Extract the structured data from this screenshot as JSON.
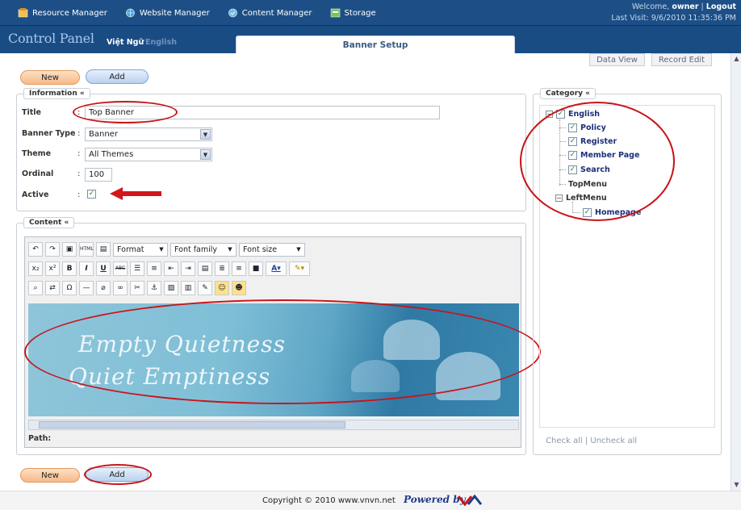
{
  "topmenu": {
    "items": [
      {
        "label": "Resource Manager",
        "icon": "resource-icon"
      },
      {
        "label": "Website Manager",
        "icon": "globe-icon"
      },
      {
        "label": "Content Manager",
        "icon": "content-icon"
      },
      {
        "label": "Storage",
        "icon": "storage-icon"
      }
    ]
  },
  "header": {
    "logo": "Control Panel",
    "lang_vi": "Việt Ngữ",
    "lang_en": "English",
    "page_title": "Banner Setup",
    "welcome_prefix": "Welcome,",
    "username": "owner",
    "logout": "Logout",
    "last_visit": "Last Visit: 9/6/2010 11:35:36 PM"
  },
  "view_tabs": {
    "data_view": "Data View",
    "record_edit": "Record Edit"
  },
  "buttons": {
    "new": "New",
    "add": "Add"
  },
  "information": {
    "legend": "Information «",
    "title_label": "Title",
    "title_value": "Top Banner",
    "banner_type_label": "Banner Type",
    "banner_type_value": "Banner",
    "theme_label": "Theme",
    "theme_value": "All Themes",
    "ordinal_label": "Ordinal",
    "ordinal_value": "100",
    "active_label": "Active",
    "active_checked": true
  },
  "content": {
    "legend": "Content «",
    "format": "Format",
    "font_family": "Font family",
    "font_size": "Font size",
    "banner_line1": "Empty Quietness",
    "banner_line2": "Quiet Emptiness",
    "path_label": "Path:"
  },
  "category": {
    "legend": "Category «",
    "root": "English",
    "children": [
      "Policy",
      "Register",
      "Member Page",
      "Search"
    ],
    "topmenu": "TopMenu",
    "leftmenu": "LeftMenu",
    "homepage": "Homepage",
    "check_all": "Check all",
    "separator": "|",
    "uncheck_all": "Uncheck all"
  },
  "footer": {
    "copyright": "Copyright © 2010 www.vnvn.net",
    "powered": "Powered by"
  },
  "colors": {
    "header_bg": "#1d4f86",
    "annotation_red": "#c8141a",
    "new_button": "#f7b888",
    "add_button": "#b8d2f0"
  }
}
